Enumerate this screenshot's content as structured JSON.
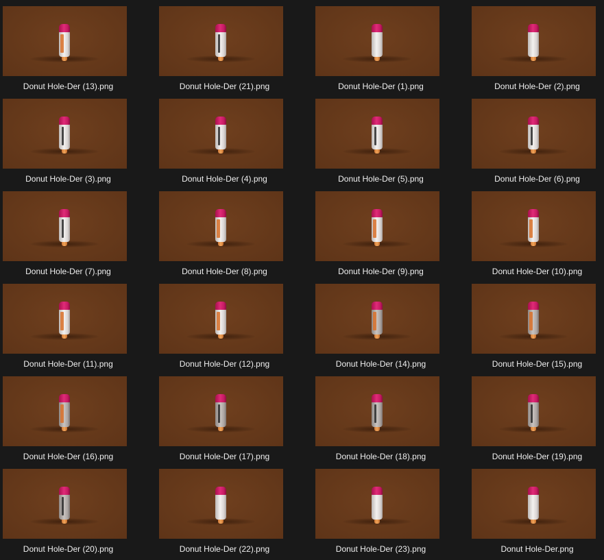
{
  "files": [
    {
      "name": "Donut Hole-Der (13).png",
      "variant": "side",
      "icon": "image-thumbnail-icon"
    },
    {
      "name": "Donut Hole-Der (21).png",
      "variant": "front",
      "icon": "image-thumbnail-icon"
    },
    {
      "name": "Donut Hole-Der (1).png",
      "variant": "plain",
      "icon": "image-thumbnail-icon"
    },
    {
      "name": "Donut Hole-Der (2).png",
      "variant": "plain",
      "icon": "image-thumbnail-icon"
    },
    {
      "name": "Donut Hole-Der (3).png",
      "variant": "front",
      "icon": "image-thumbnail-icon"
    },
    {
      "name": "Donut Hole-Der (4).png",
      "variant": "front",
      "icon": "image-thumbnail-icon"
    },
    {
      "name": "Donut Hole-Der (5).png",
      "variant": "front",
      "icon": "image-thumbnail-icon"
    },
    {
      "name": "Donut Hole-Der (6).png",
      "variant": "front",
      "icon": "image-thumbnail-icon"
    },
    {
      "name": "Donut Hole-Der (7).png",
      "variant": "front",
      "icon": "image-thumbnail-icon"
    },
    {
      "name": "Donut Hole-Der (8).png",
      "variant": "side",
      "icon": "image-thumbnail-icon"
    },
    {
      "name": "Donut Hole-Der (9).png",
      "variant": "side",
      "icon": "image-thumbnail-icon"
    },
    {
      "name": "Donut Hole-Der (10).png",
      "variant": "side",
      "icon": "image-thumbnail-icon"
    },
    {
      "name": "Donut Hole-Der (11).png",
      "variant": "side",
      "icon": "image-thumbnail-icon"
    },
    {
      "name": "Donut Hole-Der (12).png",
      "variant": "side",
      "icon": "image-thumbnail-icon"
    },
    {
      "name": "Donut Hole-Der (14).png",
      "variant": "side-dim",
      "icon": "image-thumbnail-icon"
    },
    {
      "name": "Donut Hole-Der (15).png",
      "variant": "side-dim",
      "icon": "image-thumbnail-icon"
    },
    {
      "name": "Donut Hole-Der (16).png",
      "variant": "side-dim",
      "icon": "image-thumbnail-icon"
    },
    {
      "name": "Donut Hole-Der (17).png",
      "variant": "front-dim",
      "icon": "image-thumbnail-icon"
    },
    {
      "name": "Donut Hole-Der (18).png",
      "variant": "front-dim",
      "icon": "image-thumbnail-icon"
    },
    {
      "name": "Donut Hole-Der (19).png",
      "variant": "front-dim",
      "icon": "image-thumbnail-icon"
    },
    {
      "name": "Donut Hole-Der (20).png",
      "variant": "front-dim",
      "icon": "image-thumbnail-icon"
    },
    {
      "name": "Donut Hole-Der (22).png",
      "variant": "plain",
      "icon": "image-thumbnail-icon"
    },
    {
      "name": "Donut Hole-Der (23).png",
      "variant": "plain",
      "icon": "image-thumbnail-icon"
    },
    {
      "name": "Donut Hole-Der.png",
      "variant": "plain",
      "icon": "image-thumbnail-icon"
    }
  ],
  "colors": {
    "window_background": "#191919",
    "thumbnail_background": "#673a1b",
    "caption_text": "#f0f0f0",
    "cap_pink": "#e02b78"
  }
}
